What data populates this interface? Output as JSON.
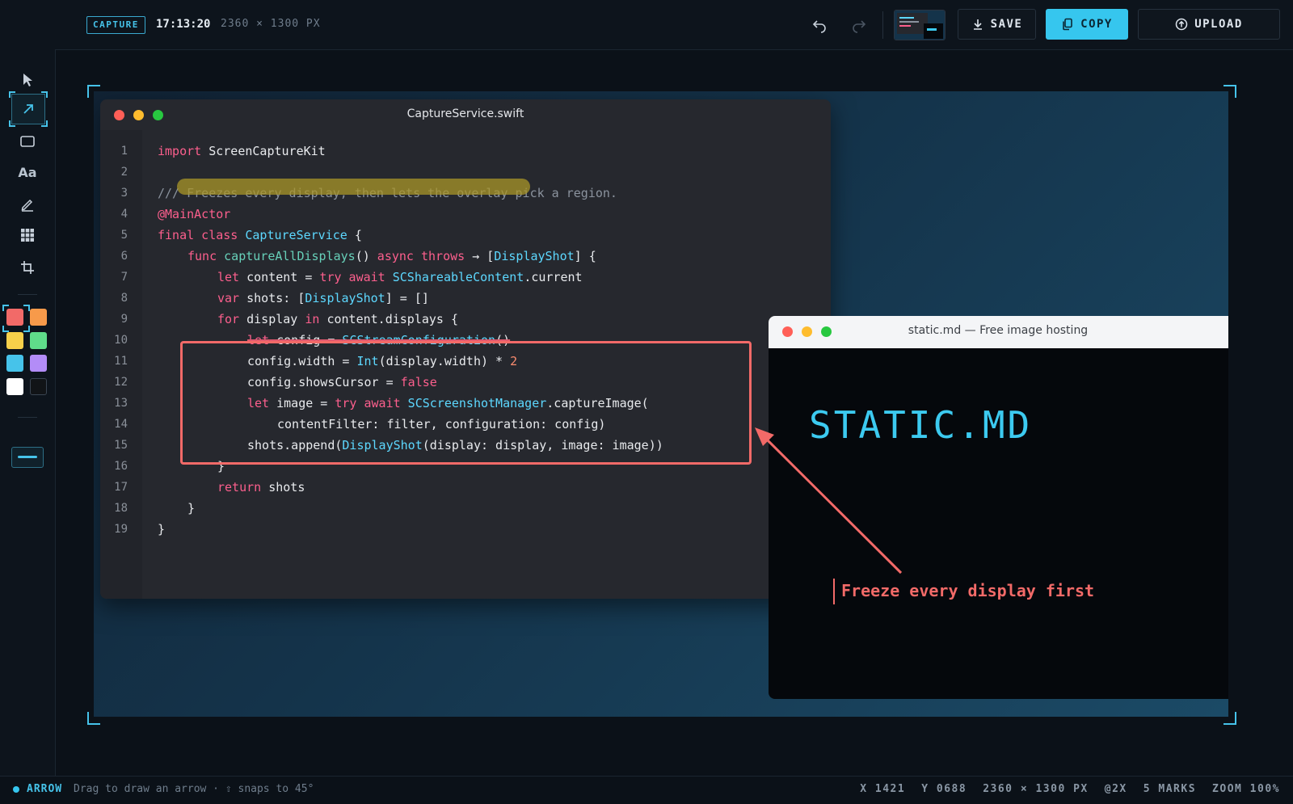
{
  "header": {
    "badge": "CAPTURE",
    "time": "17:13:20",
    "dimensions": "2360 × 1300 PX",
    "save_label": "SAVE",
    "copy_label": "COPY",
    "upload_label": "UPLOAD"
  },
  "tools": {
    "items": [
      "select-tool",
      "arrow-tool",
      "rectangle-tool",
      "text-tool",
      "pen-tool",
      "pixelate-tool",
      "crop-tool"
    ],
    "text_tool_label": "Aa",
    "active": "arrow-tool"
  },
  "palette": {
    "colors": [
      "#f26a68",
      "#f79a4a",
      "#f7d04a",
      "#5fdc8a",
      "#46c3ea",
      "#b38cf7",
      "#ffffff",
      "#111417"
    ],
    "selected": "#f26a68"
  },
  "stroke_widths": [
    "thin",
    "medium",
    "thick"
  ],
  "code_window": {
    "title": "CaptureService.swift",
    "line_numbers": [
      "1",
      "2",
      "3",
      "4",
      "5",
      "6",
      "7",
      "8",
      "9",
      "10",
      "11",
      "12",
      "13",
      "14",
      "15",
      "16",
      "17",
      "18",
      "19"
    ],
    "lines": {
      "l1_kw": "import",
      "l1_rest": " ScreenCaptureKit",
      "l3": "/// Freezes every display, then lets the overlay pick a region.",
      "l4": "@MainActor",
      "l5_kw": "final class",
      "l5_ty": " CaptureService",
      "l5_rest": " {",
      "l6_kw": "func",
      "l6_fn": " captureAllDisplays",
      "l6_p": "()",
      "l6_kw2": " async throws",
      "l6_arrow": " → [",
      "l6_ty": "DisplayShot",
      "l6_end": "] {",
      "l7_kw": "let",
      "l7_a": " content = ",
      "l7_kw2": "try await",
      "l7_ty": " SCShareableContent",
      "l7_end": ".current",
      "l8_kw": "var",
      "l8_a": " shots: [",
      "l8_ty": "DisplayShot",
      "l8_end": "] = []",
      "l9_kw": "for",
      "l9_a": " display ",
      "l9_kw2": "in",
      "l9_end": " content.displays {",
      "l10_kw": "let",
      "l10_a": " config = ",
      "l10_ty": "SCStreamConfiguration",
      "l10_end": "()",
      "l11_a": "config.width = ",
      "l11_ty": "Int",
      "l11_b": "(display.width) * ",
      "l11_nm": "2",
      "l12_a": "config.showsCursor = ",
      "l12_kw": "false",
      "l13_kw": "let",
      "l13_a": " image = ",
      "l13_kw2": "try await",
      "l13_ty": " SCScreenshotManager",
      "l13_end": ".captureImage(",
      "l14": "contentFilter: filter, configuration: config)",
      "l15_a": "shots.append(",
      "l15_ty": "DisplayShot",
      "l15_end": "(display: display, image: image))",
      "l16": "}",
      "l17_kw": "return",
      "l17_end": " shots",
      "l18": "}",
      "l19": "}"
    }
  },
  "browser_window": {
    "title": "static.md — Free image hosting",
    "brand": "STATIC.MD"
  },
  "annotation": {
    "text": "Freeze every display first",
    "color": "#f26a68"
  },
  "status": {
    "mode": "ARROW",
    "hint": "Drag to draw an arrow · ⇧ snaps to 45°",
    "x": "X 1421",
    "y": "Y 0688",
    "size": "2360 × 1300 PX",
    "scale": "@2X",
    "marks": "5 MARKS",
    "zoom": "ZOOM 100%"
  }
}
